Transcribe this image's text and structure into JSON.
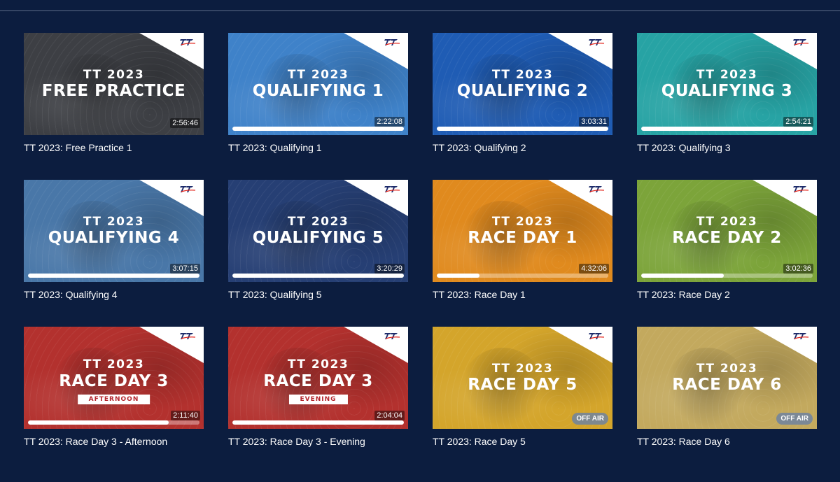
{
  "videos": [
    {
      "caption": "TT 2023: Free Practice 1",
      "year": "TT 2023",
      "title": "FREE PRACTICE",
      "subtitle": "",
      "duration": "2:56:46",
      "progress": null,
      "offair": "",
      "color": "#3d3f44"
    },
    {
      "caption": "TT 2023: Qualifying 1",
      "year": "TT 2023",
      "title": "QUALIFYING 1",
      "subtitle": "",
      "duration": "2:22:08",
      "progress": 1.0,
      "offair": "",
      "color": "#3f82c9"
    },
    {
      "caption": "TT 2023: Qualifying 2",
      "year": "TT 2023",
      "title": "QUALIFYING 2",
      "subtitle": "",
      "duration": "3:03:31",
      "progress": 1.0,
      "offair": "",
      "color": "#1f5cb4"
    },
    {
      "caption": "TT 2023: Qualifying 3",
      "year": "TT 2023",
      "title": "QUALIFYING 3",
      "subtitle": "",
      "duration": "2:54:21",
      "progress": 1.0,
      "offair": "",
      "color": "#27a3a4"
    },
    {
      "caption": "TT 2023: Qualifying 4",
      "year": "TT 2023",
      "title": "QUALIFYING 4",
      "subtitle": "",
      "duration": "3:07:15",
      "progress": 1.0,
      "offair": "",
      "color": "#4977a8"
    },
    {
      "caption": "TT 2023: Qualifying 5",
      "year": "TT 2023",
      "title": "QUALIFYING 5",
      "subtitle": "",
      "duration": "3:20:29",
      "progress": 1.0,
      "offair": "",
      "color": "#263f74"
    },
    {
      "caption": "TT 2023: Race Day 1",
      "year": "TT 2023",
      "title": "RACE DAY 1",
      "subtitle": "",
      "duration": "4:32:06",
      "progress": 0.25,
      "offair": "",
      "color": "#e08a1e"
    },
    {
      "caption": "TT 2023: Race Day 2",
      "year": "TT 2023",
      "title": "RACE DAY 2",
      "subtitle": "",
      "duration": "3:02:36",
      "progress": 0.48,
      "offair": "",
      "color": "#7ca43a"
    },
    {
      "caption": "TT 2023: Race Day 3 - Afternoon",
      "year": "TT 2023",
      "title": "RACE DAY 3",
      "subtitle": "AFTERNOON",
      "duration": "2:11:40",
      "progress": 0.82,
      "offair": "",
      "color": "#b3312e"
    },
    {
      "caption": "TT 2023: Race Day 3 - Evening",
      "year": "TT 2023",
      "title": "RACE DAY 3",
      "subtitle": "EVENING",
      "duration": "2:04:04",
      "progress": 1.0,
      "offair": "",
      "color": "#b3312e"
    },
    {
      "caption": "TT 2023: Race Day 5",
      "year": "TT 2023",
      "title": "RACE DAY 5",
      "subtitle": "",
      "duration": "",
      "progress": null,
      "offair": "OFF AIR",
      "color": "#d4a52b"
    },
    {
      "caption": "TT 2023: Race Day 6",
      "year": "TT 2023",
      "title": "RACE DAY 6",
      "subtitle": "",
      "duration": "",
      "progress": null,
      "offair": "OFF AIR",
      "color": "#c3a95e"
    }
  ]
}
